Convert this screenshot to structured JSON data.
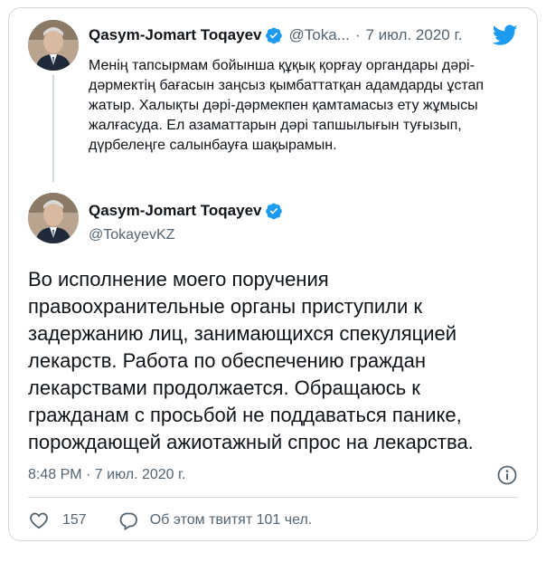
{
  "parent_tweet": {
    "author_name": "Qasym-Jomart Toqayev",
    "handle": "@Toka...",
    "separator": "·",
    "date": "7 июл. 2020 г.",
    "text": "Менің тапсырмам бойынша құқық қорғау органдары дәрі-дәрмектің бағасын заңсыз қымбаттатқан адамдарды ұстап жатыр. Халықты дәрі-дәрмекпен қамтамасыз ету жұмысы жалғасуда. Ел азаматтарын дәрі тапшылығын туғызып, дүрбелеңге салынбауға шақырамын."
  },
  "main_tweet": {
    "author_name": "Qasym-Jomart Toqayev",
    "handle": "@TokayevKZ",
    "text": "Во исполнение моего поручения правоохранительные органы приступили к задержанию лиц, занимающихся спекуляцией лекарств. Работа по обеспечению граждан лекарствами продолжается. Обращаюсь к гражданам с просьбой не поддаваться панике, порождающей ажиотажный спрос на лекарства.",
    "timestamp": "8:48 PM · 7 июл. 2020 г.",
    "like_count": "157",
    "discussion_text": "Об этом твитят 101 чел."
  },
  "colors": {
    "accent": "#1d9bf0",
    "text_primary": "#0f1419",
    "text_secondary": "#536471",
    "border": "#cfd9de"
  },
  "icons": {
    "verified": "verified-badge-icon",
    "logo": "twitter-bird-icon",
    "info": "info-icon",
    "like": "heart-icon",
    "comment": "speech-bubble-icon"
  }
}
